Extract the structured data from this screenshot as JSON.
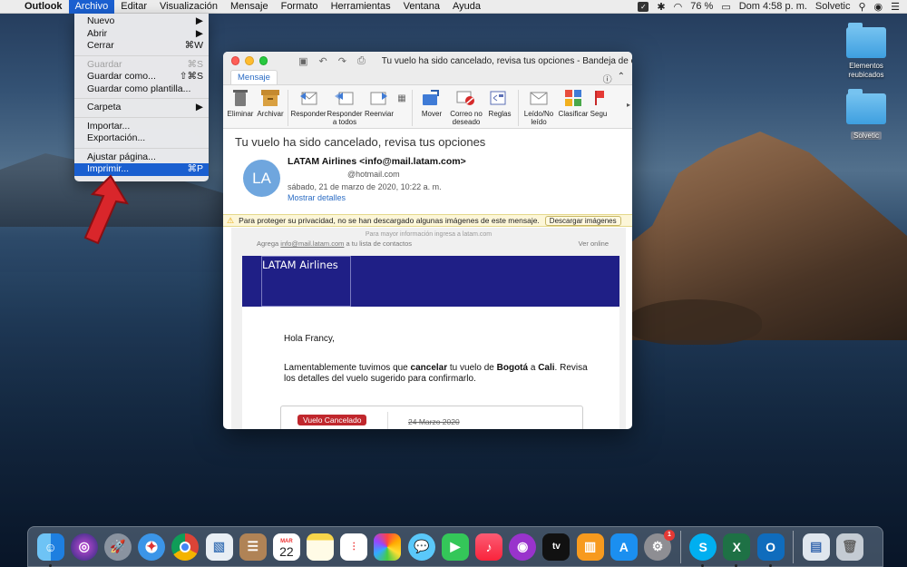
{
  "menubar": {
    "apple": "",
    "items": [
      "Outlook",
      "Archivo",
      "Editar",
      "Visualización",
      "Mensaje",
      "Formato",
      "Herramientas",
      "Ventana",
      "Ayuda"
    ],
    "battery": "76 %",
    "clock": "Dom 4:58 p. m.",
    "user": "Solvetic"
  },
  "file_menu": {
    "nuevo": "Nuevo",
    "abrir": "Abrir",
    "cerrar": "Cerrar",
    "cerrar_sc": "⌘W",
    "guardar": "Guardar",
    "guardar_sc": "⌘S",
    "guardar_como": "Guardar como...",
    "guardar_como_sc": "⇧⌘S",
    "guardar_plantilla": "Guardar como plantilla...",
    "carpeta": "Carpeta",
    "importar": "Importar...",
    "exportacion": "Exportación...",
    "ajustar": "Ajustar página...",
    "imprimir": "Imprimir...",
    "imprimir_sc": "⌘P"
  },
  "window": {
    "title": "Tu vuelo ha sido cancelado, revisa tus opciones - Bandeja de entr...",
    "tab": "Mensaje",
    "ribbon": {
      "eliminar": "Eliminar",
      "archivar": "Archivar",
      "responder": "Responder",
      "responder_todos_1": "Responder",
      "responder_todos_2": "a todos",
      "reenviar": "Reenviar",
      "mover": "Mover",
      "correo_1": "Correo no",
      "correo_2": "deseado",
      "reglas": "Reglas",
      "leido_1": "Leído/No",
      "leido_2": "leído",
      "clasificar": "Clasificar",
      "seguimiento": "Segu"
    },
    "subject": "Tu vuelo ha sido cancelado, revisa tus opciones",
    "avatar": "LA",
    "sender": "LATAM Airlines <info@mail.latam.com>",
    "to": "@hotmail.com",
    "date": "sábado, 21 de marzo de 2020, 10:22 a. m.",
    "details": "Mostrar detalles",
    "privacy": "Para proteger su privacidad, no se han descargado algunas imágenes de este mensaje.",
    "download": "Descargar imágenes"
  },
  "email": {
    "top_info": "Para mayor información ingresa a latam.com",
    "agrega": "Agrega",
    "agrega_email": "info@mail.latam.com",
    "agrega_rest": "a tu lista de contactos",
    "ver_online": "Ver online",
    "banner": "LATAM Airlines",
    "greeting": "Hola Francy,",
    "body_1": "Lamentablemente tuvimos que",
    "body_b1": "cancelar",
    "body_2": "tu vuelo de",
    "body_b2": "Bogotá",
    "body_3": "a",
    "body_b3": "Cali",
    "body_4": ". Revisa los detalles del vuelo sugerido para confirmarlo.",
    "tag": "Vuelo Cancelado",
    "old_date": "24 Marzo 2020"
  },
  "desktop": {
    "icon1": "Elementos reubicados",
    "icon2": "Solvetic"
  },
  "dock": {
    "calendar_month": "MAR",
    "calendar_day": "22",
    "appstore_badge": "1"
  }
}
